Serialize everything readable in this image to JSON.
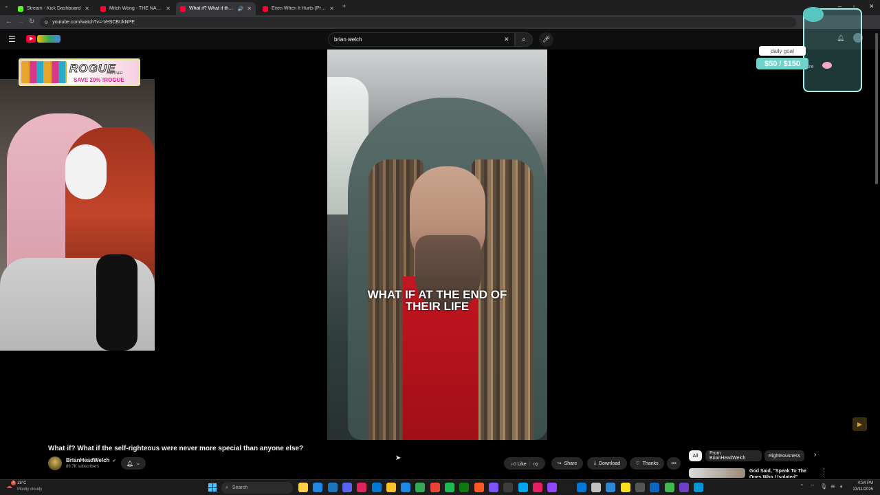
{
  "browser": {
    "tabs": [
      {
        "title": "Stream - Kick Dashboard",
        "favicon_color": "#53fc18",
        "active": false
      },
      {
        "title": "Mitch Wong - THE NAME ABOVE",
        "favicon_color": "#ff0033",
        "active": false
      },
      {
        "title": "What if? What if the self-ri",
        "favicon_color": "#ff0033",
        "active": true
      },
      {
        "title": "Even When It Hurts (Praise Son",
        "favicon_color": "#ff0033",
        "active": false
      }
    ],
    "new_tab": "+",
    "url": "youtube.com/watch?v=-VeSCBUkNPE",
    "window_controls": [
      "–",
      "▫",
      "✕"
    ]
  },
  "youtube": {
    "search_value": "brian welch",
    "clear": "✕",
    "create_label": "Cre",
    "video": {
      "caption_line1": "WHAT IF AT THE END OF",
      "caption_line2": "THEIR LIFE",
      "title": "What if? What if the self-righteous were never more special than anyone else?",
      "channel": "BrianHeadWelch",
      "verified": "✔",
      "subscribers": "89.7K subscribers"
    },
    "actions": {
      "like": "Like",
      "share": "Share",
      "download": "Download",
      "thanks": "Thanks",
      "more": "•••"
    },
    "chips": [
      "All",
      "From BrianHeadWelch",
      "Righteousness"
    ],
    "recommendation": {
      "title": "God Said, \"Speak To The Ones Who I Isolated\""
    }
  },
  "overlay": {
    "sponsor_logo": "ROGUE",
    "sponsor_sub": "PARTNER",
    "sponsor_code": "SAVE 20% !ROGUE",
    "goal_label": "daily goal",
    "goal_value": "$50 / $150",
    "goal_progress": 0.333
  },
  "taskbar": {
    "weather_temp": "18°C",
    "weather_desc": "Mostly cloudy",
    "weather_badge": "3",
    "search_label": "Search",
    "time": "4:34 PM",
    "date": "13/11/2025",
    "app_colors": [
      "#ffcf48",
      "#1e88e5",
      "#1b75bb",
      "#5865f2",
      "#e0245e",
      "#0078d4",
      "#fbc02d",
      "#1e88e5",
      "#34a853",
      "#ea4335",
      "#1db954",
      "#0e7a0d",
      "#ff5722",
      "#7f52ff",
      "#3c3c3c",
      "#00a4ef",
      "#e91e63",
      "#9146ff",
      "#1e1e1e",
      "#0078d7",
      "#c1c1c1",
      "#2b88d8",
      "#f7df1e",
      "#555555",
      "#0a66c2",
      "#3fb950",
      "#6e40c9",
      "#0095d5"
    ]
  },
  "colors": {
    "youtube_red": "#ff0033",
    "goal_teal": "#6fd3c9",
    "sponsor_pink": "#e6237f"
  }
}
